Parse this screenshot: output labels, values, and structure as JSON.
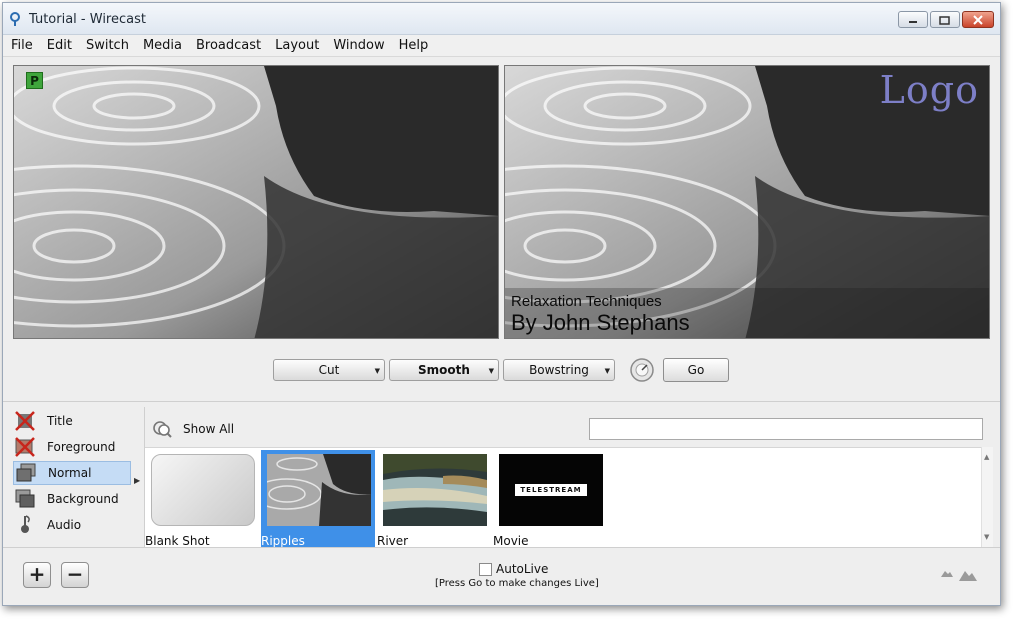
{
  "window": {
    "title": "Tutorial - Wirecast"
  },
  "menu": [
    "File",
    "Edit",
    "Switch",
    "Media",
    "Broadcast",
    "Layout",
    "Window",
    "Help"
  ],
  "preview": {
    "badge": "P",
    "logo": "Logo",
    "lower_third_line1": "Relaxation Techniques",
    "lower_third_line2": "By John Stephans"
  },
  "transitions": {
    "cut": "Cut",
    "smooth": "Smooth",
    "bowstring": "Bowstring",
    "go": "Go"
  },
  "layers": [
    {
      "label": "Title",
      "icon": "title-layer-icon"
    },
    {
      "label": "Foreground",
      "icon": "foreground-layer-icon"
    },
    {
      "label": "Normal",
      "icon": "normal-layer-icon",
      "selected": true
    },
    {
      "label": "Background",
      "icon": "background-layer-icon"
    },
    {
      "label": "Audio",
      "icon": "audio-layer-icon"
    }
  ],
  "shots_header": {
    "show_all": "Show All",
    "search_value": ""
  },
  "shots": [
    {
      "label": "Blank Shot"
    },
    {
      "label": "Ripples",
      "selected": true
    },
    {
      "label": "River"
    },
    {
      "label": "Movie",
      "thumb_text": "TELESTREAM"
    }
  ],
  "bottom": {
    "add": "+",
    "remove": "−",
    "autolive_label": "AutoLive",
    "autolive_note": "[Press Go to make changes Live]"
  },
  "colors": {
    "selection": "#3f90e8",
    "layer_selection": "#c5dcf5",
    "logo": "#7d7fc7",
    "badge": "#3fa53c"
  }
}
